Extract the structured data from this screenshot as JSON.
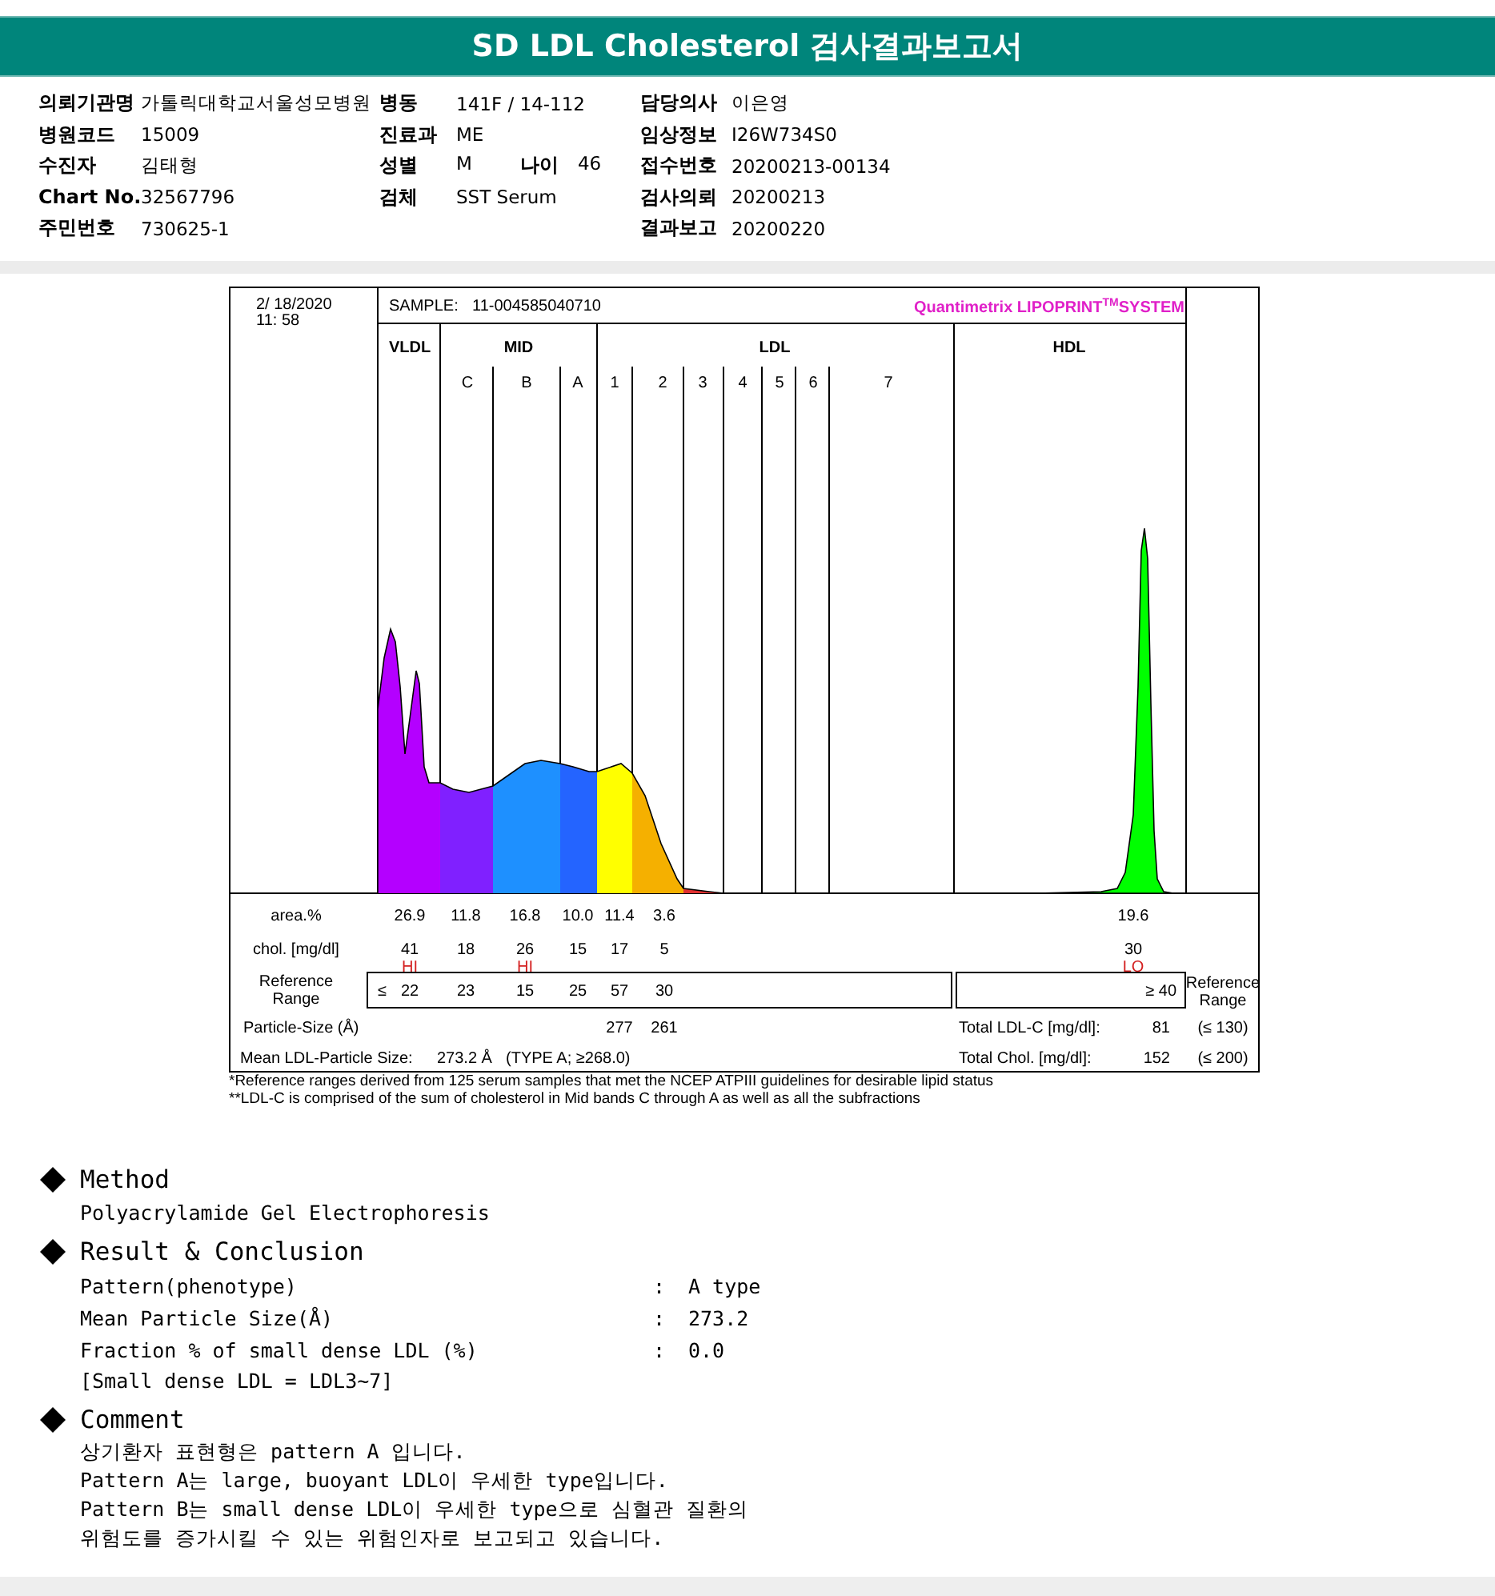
{
  "header": {
    "title": "SD LDL Cholesterol 검사결과보고서"
  },
  "info": {
    "columns": [
      [
        {
          "label": "의뢰기관명",
          "value": "가톨릭대학교서울성모병원"
        },
        {
          "label": "병원코드",
          "value": "15009"
        },
        {
          "label": "수진자",
          "value": "김태형"
        },
        {
          "label": "Chart No.",
          "value": "32567796"
        },
        {
          "label": "주민번호",
          "value": "730625-1"
        }
      ],
      [
        {
          "label": "병동",
          "value": "141F / 14-112"
        },
        {
          "label": "진료과",
          "value": "ME"
        },
        {
          "label": "성별",
          "value": "M",
          "extra_label": "나이",
          "extra_value": "46"
        },
        {
          "label": "검체",
          "value": "SST Serum"
        }
      ],
      [
        {
          "label": "담당의사",
          "value": "이은영"
        },
        {
          "label": "임상정보",
          "value": "I26W734S0"
        },
        {
          "label": "접수번호",
          "value": "20200213-00134"
        },
        {
          "label": "검사의뢰",
          "value": "20200213"
        },
        {
          "label": "결과보고",
          "value": "20200220"
        }
      ]
    ]
  },
  "chart": {
    "date": "2/ 18/2020",
    "time": "11: 58",
    "sample_label": "SAMPLE:",
    "sample_id": "11-004585040710",
    "brand": "Quantimetrix LIPOPRINT",
    "brand_superscript": "TM",
    "brand_tail": "SYSTEM",
    "groups": [
      "VLDL",
      "MID",
      "LDL",
      "HDL"
    ],
    "subbands": [
      "C",
      "B",
      "A",
      "1",
      "2",
      "3",
      "4",
      "5",
      "6",
      "7"
    ],
    "area": {
      "label": "area.%",
      "values": [
        "26.9",
        "11.8",
        "16.8",
        "10.0",
        "11.4",
        "3.6"
      ],
      "hdl": "19.6"
    },
    "chol": {
      "label": "chol. [mg/dl]",
      "values": [
        {
          "value": "41",
          "flag": "HI"
        },
        {
          "value": "18"
        },
        {
          "value": "26",
          "flag": "HI"
        },
        {
          "value": "15"
        },
        {
          "value": "17"
        },
        {
          "value": "5"
        }
      ],
      "hdl": {
        "value": "30",
        "flag": "LO"
      }
    },
    "reference": {
      "label": [
        "Reference",
        "Range"
      ],
      "sign": "≤",
      "values": [
        "22",
        "23",
        "15",
        "25",
        "57",
        "30"
      ],
      "hdl": "≥ 40",
      "side_label": [
        "Reference",
        "Range"
      ]
    },
    "particle_size": {
      "label": "Particle-Size (Å)",
      "values": [
        "277",
        "261"
      ]
    },
    "mean": {
      "label": "Mean LDL-Particle Size:",
      "value": "273.2 Å",
      "type": "(TYPE A; ≥268.0)"
    },
    "totals": [
      {
        "label": "Total LDL-C [mg/dl]:",
        "value": "81",
        "range": "(≤ 130)"
      },
      {
        "label": "Total Chol. [mg/dl]:",
        "value": "152",
        "range": "(≤ 200)"
      }
    ],
    "footnotes": [
      "*Reference ranges derived from 125 serum samples that met the NCEP ATPIII guidelines for desirable lipid status",
      "**LDL-C is comprised of the sum of cholesterol in Mid bands C through A as well as all the subfractions"
    ]
  },
  "sections": [
    {
      "kind": "lines",
      "heading": "Method",
      "lines": [
        "Polyacrylamide Gel Electrophoresis"
      ]
    },
    {
      "kind": "results",
      "heading": "Result & Conclusion",
      "rows": [
        {
          "label": "Pattern(phenotype)",
          "separator": ":",
          "value": "A type"
        },
        {
          "label": "Mean Particle Size(Å)",
          "separator": ":",
          "value": "273.2"
        },
        {
          "label": "Fraction % of small dense LDL (%)",
          "separator": ":",
          "value": "0.0"
        }
      ],
      "note": "[Small dense LDL = LDL3~7]"
    },
    {
      "kind": "lines",
      "heading": "Comment",
      "lines": [
        "상기환자 표현형은 pattern A 입니다.",
        "Pattern A는 large, buoyant LDL이 우세한 type입니다.",
        "Pattern B는 small dense LDL이 우세한 type으로 심혈관 질환의",
        "위험도를 증가시킬 수 있는 위험인자로 보고되고 있습니다."
      ]
    }
  ]
}
